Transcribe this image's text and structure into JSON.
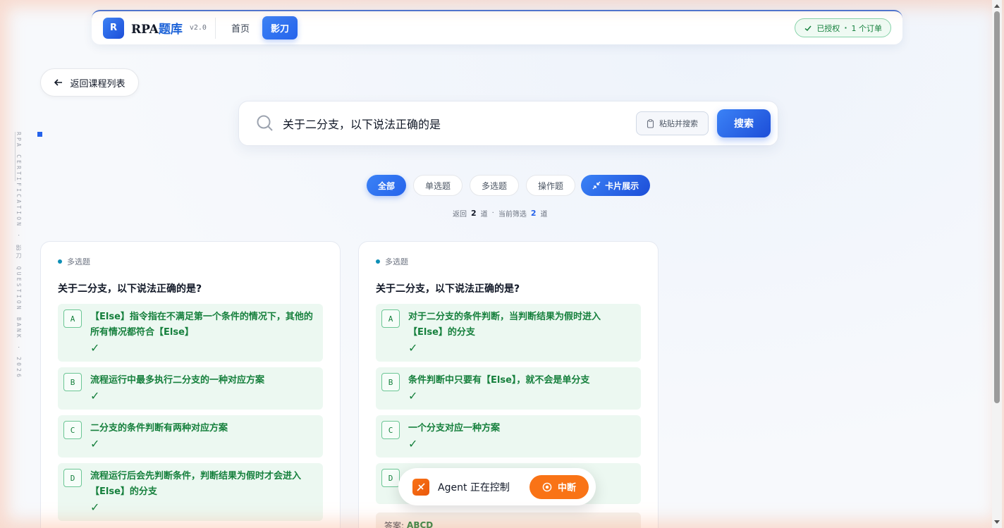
{
  "app": {
    "logo_letter": "R",
    "title_prefix": "RPA",
    "title_suffix": "题库",
    "version": "v2.0"
  },
  "nav": {
    "items": [
      {
        "label": "首页",
        "active": false
      },
      {
        "label": "影刀",
        "active": true
      }
    ]
  },
  "license": {
    "status": "已授权",
    "separator": "·",
    "orders": "1 个订单"
  },
  "back_button": {
    "label": "返回课程列表"
  },
  "side_text": {
    "line1": "RPA CERTIFICATION · 影刀 QUESTION",
    "line2": "BANK · 2026"
  },
  "search": {
    "query": "关于二分支，以下说法正确的是",
    "paste_label": "粘贴并搜索",
    "button_label": "搜索"
  },
  "filters": [
    {
      "label": "全部",
      "active": true
    },
    {
      "label": "单选题",
      "active": false
    },
    {
      "label": "多选题",
      "active": false
    },
    {
      "label": "操作题",
      "active": false
    }
  ],
  "view_toggle": {
    "label": "卡片展示"
  },
  "results": {
    "prefix": "返回",
    "returned": "2",
    "unit1": "道",
    "dot": "·",
    "filter_prefix": "当前筛选",
    "filtered": "2",
    "unit2": "道"
  },
  "cards": [
    {
      "type": "多选题",
      "question": "关于二分支，以下说法正确的是?",
      "options": [
        {
          "letter": "A",
          "text": "【Else】指令指在不满足第一个条件的情况下，其他的所有情况都符合【Else】",
          "check": "✓"
        },
        {
          "letter": "B",
          "text": "流程运行中最多执行二分支的一种对应方案",
          "check": "✓"
        },
        {
          "letter": "C",
          "text": "二分支的条件判断有两种对应方案",
          "check": "✓"
        },
        {
          "letter": "D",
          "text": "流程运行后会先判断条件，判断结果为假时才会进入【Else】的分支",
          "check": "✓"
        }
      ]
    },
    {
      "type": "多选题",
      "question": "关于二分支，以下说法正确的是?",
      "options": [
        {
          "letter": "A",
          "text": "对于二分支的条件判断，当判断结果为假时进入【Else】的分支",
          "check": "✓"
        },
        {
          "letter": "B",
          "text": "条件判断中只要有【Else】，就不会是单分支",
          "check": "✓"
        },
        {
          "letter": "C",
          "text": "一个分支对应一种方案",
          "check": "✓"
        },
        {
          "letter": "D",
          "text": "",
          "check": ""
        }
      ],
      "answer_label": "答案:",
      "answer_value": "ABCD"
    }
  ],
  "agent": {
    "status": "Agent 正在控制",
    "stop_label": "中断"
  }
}
